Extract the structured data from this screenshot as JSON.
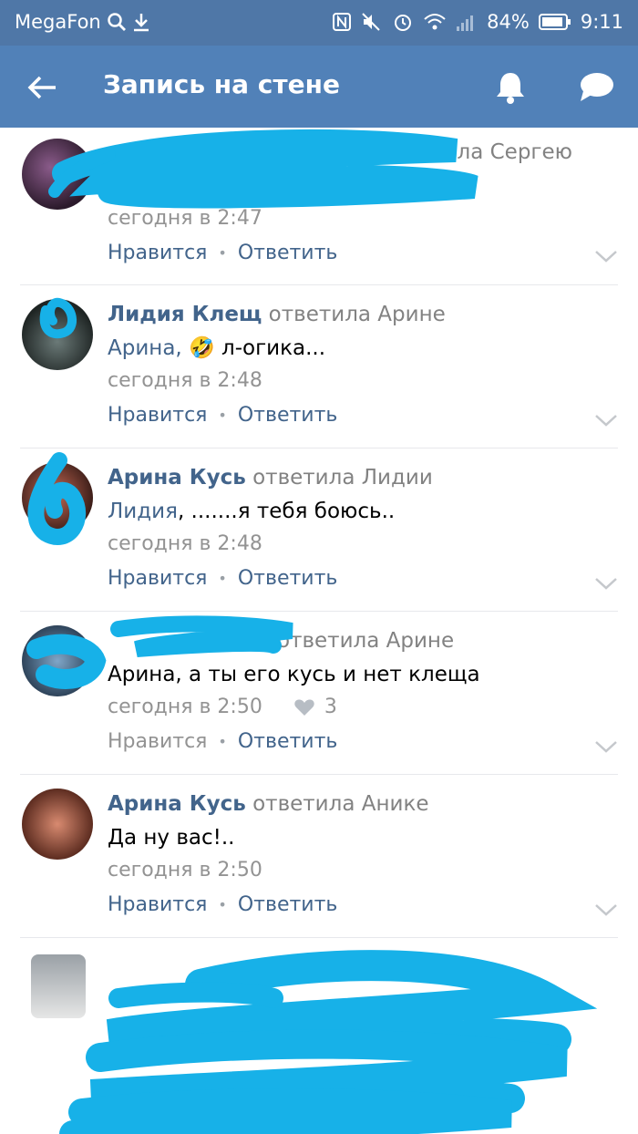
{
  "status_bar": {
    "carrier": "MegaFon",
    "battery": "84%",
    "time": "9:11"
  },
  "header": {
    "title": "Запись на стене"
  },
  "comments": [
    {
      "author": "",
      "replied_to": "ответила Сергею",
      "text": ")",
      "time": "сегодня в 2:47",
      "like_label": "Нравится",
      "reply_label": "Ответить"
    },
    {
      "author": "Лидия Клещ",
      "replied_to": "ответила Арине",
      "mention": "Арина,",
      "emoji": "🤣",
      "text": "л-огика...",
      "time": "сегодня в 2:48",
      "like_label": "Нравится",
      "reply_label": "Ответить"
    },
    {
      "author": "Арина Кусь",
      "replied_to": "ответила Лидии",
      "mention": "Лидия",
      "text": ", .......я тебя боюсь..",
      "time": "сегодня в 2:48",
      "like_label": "Нравится",
      "reply_label": "Ответить"
    },
    {
      "author": "",
      "replied_to": "ответила Арине",
      "text": "Арина, а ты его кусь и нет клеща",
      "time": "сегодня в 2:50",
      "likes_count": "3",
      "like_label": "Нравится",
      "reply_label": "Ответить"
    },
    {
      "author": "Арина Кусь",
      "replied_to": "ответила Анике",
      "text": "Да ну вас!..",
      "time": "сегодня в 2:50",
      "like_label": "Нравится",
      "reply_label": "Ответить"
    }
  ],
  "colors": {
    "status_bar": "#4f77a7",
    "nav_bar": "#5181b8",
    "link": "#42648b",
    "scribble": "#17b1e8"
  }
}
